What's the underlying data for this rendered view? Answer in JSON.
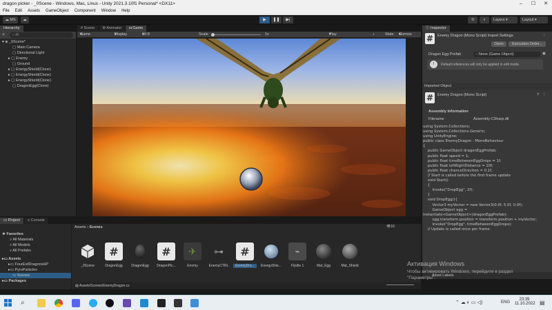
{
  "window": {
    "title": "dragon picker - _0Scene - Windows, Mac, Linux - Unity 2021.3.10f1 Personal* <DX11>"
  },
  "menu": [
    "File",
    "Edit",
    "Assets",
    "GameObject",
    "Component",
    "Window",
    "Help"
  ],
  "toolbar": {
    "account": "MS",
    "layers": "Layers",
    "layout": "Layout"
  },
  "hierarchy": {
    "tab": "Hierarchy",
    "search_placeholder": "All",
    "scene": "_0Scene*",
    "items": [
      "Main Camera",
      "Directional Light",
      "Enemy",
      "Ground",
      "EnergyShield(Clone)",
      "EnergyShield(Clone)",
      "EnergyShield(Clone)",
      "DragonEgg(Clone)"
    ]
  },
  "center_tabs": [
    "Scene",
    "Animator",
    "Game"
  ],
  "game_bar": {
    "mode": "Game",
    "display": "Display 1",
    "aspect": "16:9 Aspect",
    "scale_label": "Scale",
    "scale_value": "1x",
    "play_focused": "Play Focused",
    "stats": "Stats",
    "gizmos": "Gizmos"
  },
  "inspector": {
    "tab": "Inspector",
    "header_title": "Enemy Dragon (Mono Script) Import Settings",
    "open": "Open",
    "execution_order": "Execution Order...",
    "field_label": "Dragon Egg Prefab",
    "field_value": "None (Game Object)",
    "info": "Default references will only be applied in edit mode.",
    "imported_object": "Imported Object",
    "script_name": "Enemy Dragon (Mono Script)",
    "assembly_info": "Assembly Information",
    "filename_label": "Filename",
    "filename_value": "Assembly-CSharp.dll",
    "asset_labels": "Asset Labels",
    "code_lines": [
      "using System.Collections;",
      "using System.Collections.Generic;",
      "using UnityEngine;",
      "",
      "public class EnemyDragon : MonoBehaviour",
      "{",
      "    public GameObject dragonEggPrefab;",
      "    public float speed = 1;",
      "    public float timeBetweenEggDrops = 1f;",
      "    public float leftRightDistance = 10f;",
      "    public float chanceDirection = 0.1f;",
      "    // Start is called before the first frame update",
      "    void Start()",
      "    {",
      "        Invoke(\"DropEgg\", 2f);",
      "",
      "    }",
      "",
      "    void DropEgg(){",
      "        Vector3 myVector = new Vector3(0.0f, 5.0f, 0.0f);",
      "        GameObject egg =",
      "Instantiate<GameObject>(dragonEggPrefab);",
      "        egg.transform.position = transform.position + myVector;",
      "        Invoke(\"DropEgg\", timeBetweenEggDrops);",
      "",
      "",
      "    // Update is called once per frame"
    ]
  },
  "project": {
    "tabs": [
      "Project",
      "Console"
    ],
    "breadcrumb_root": "Assets",
    "breadcrumb_leaf": "Scenes",
    "favorites": "Favorites",
    "favorite_items": [
      "All Materials",
      "All Models",
      "All Prefabs"
    ],
    "assets": "Assets",
    "asset_folders": [
      "FourEvilDragonsHP",
      "PyroParticles",
      "Scenes"
    ],
    "packages": "Packages",
    "count": "16",
    "path": "Assets/Scenes/EnemyDragon.cs",
    "files": [
      "_0Scene",
      "DragonEgg",
      "DragonEgg",
      "DragonPic...",
      "Enemy",
      "EnemyCTRL",
      "EnemyDra...",
      "EnergyShie...",
      "Flyidle 1",
      "Mat_Egg",
      "Mat_Shield"
    ]
  },
  "watermark": {
    "line1": "Активация Windows",
    "line2": "Чтобы активировать Windows, перейдите в раздел",
    "line3": "\"Параметры\"."
  },
  "taskbar": {
    "lang": "ENG",
    "time": "23:39",
    "date": "11.10.2022"
  }
}
